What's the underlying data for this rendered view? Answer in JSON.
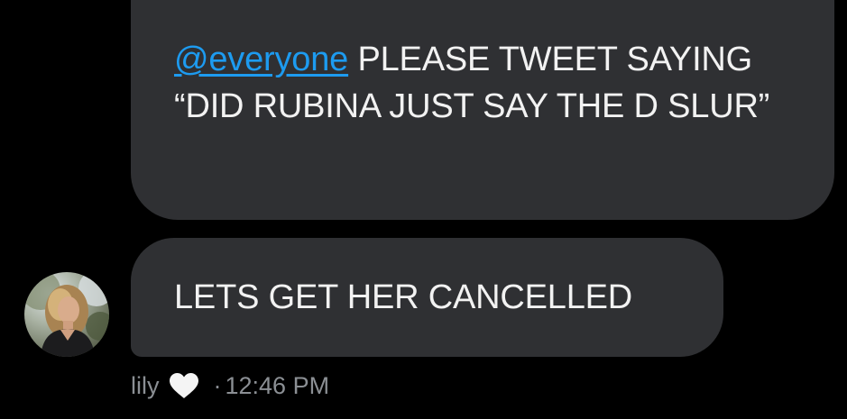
{
  "messages": [
    {
      "mention": "@everyone",
      "text": " PLEASE TWEET SAYING “DID RUBINA JUST SAY THE D SLUR”"
    },
    {
      "text": "LETS GET HER CANCELLED"
    }
  ],
  "sender": {
    "name": "lily",
    "emoji_icon": "white-heart-icon",
    "separator": "·",
    "time": "12:46 PM"
  },
  "colors": {
    "background": "#000000",
    "bubble": "#2f3033",
    "message_text": "#f2f2f2",
    "mention": "#1d9bf0",
    "meta_text": "#8b8f94"
  }
}
